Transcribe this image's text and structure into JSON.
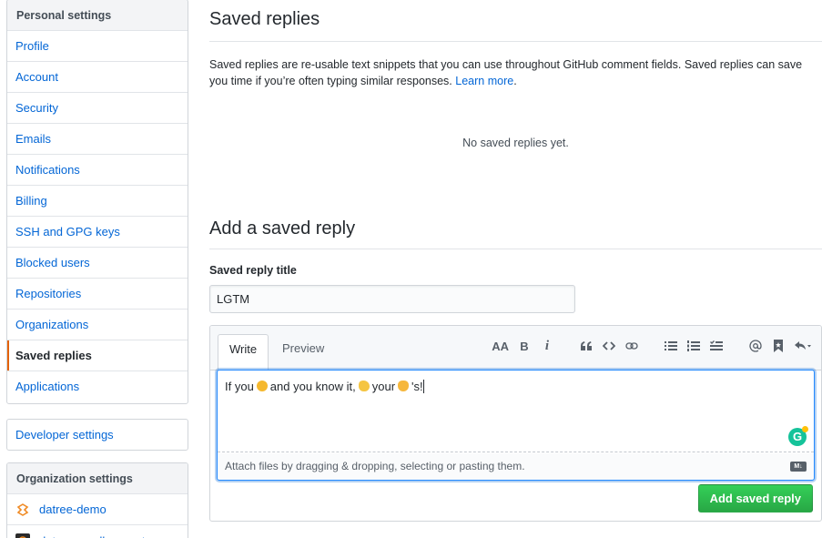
{
  "sidebar": {
    "personal_heading": "Personal settings",
    "items": [
      {
        "label": "Profile"
      },
      {
        "label": "Account"
      },
      {
        "label": "Security"
      },
      {
        "label": "Emails"
      },
      {
        "label": "Notifications"
      },
      {
        "label": "Billing"
      },
      {
        "label": "SSH and GPG keys"
      },
      {
        "label": "Blocked users"
      },
      {
        "label": "Repositories"
      },
      {
        "label": "Organizations"
      },
      {
        "label": "Saved replies",
        "selected": true
      },
      {
        "label": "Applications"
      }
    ],
    "developer_settings": "Developer settings",
    "org_heading": "Organization settings",
    "orgs": [
      {
        "label": "datree-demo"
      },
      {
        "label": "datree-sandbox-vert"
      }
    ]
  },
  "main": {
    "title": "Saved replies",
    "description": "Saved replies are re-usable text snippets that you can use throughout GitHub comment fields. Saved replies can save you time if you’re often typing similar responses.",
    "learn_more": "Learn more",
    "period": ".",
    "empty_text": "No saved replies yet.",
    "add_title": "Add a saved reply",
    "field_label": "Saved reply title",
    "title_value": "LGTM",
    "editor": {
      "tab_write": "Write",
      "tab_preview": "Preview",
      "toolbar": {
        "header": "AA",
        "bold": "B",
        "italic": "i"
      },
      "body_parts": [
        "If you",
        "and you know it,",
        "your",
        "'s!"
      ],
      "emoji_colors": [
        "#f5b82e",
        "#f5c542",
        "#f6b73c"
      ],
      "attach_text": "Attach files by dragging & dropping, selecting or pasting them.",
      "md_badge": "M↓",
      "grammarly": "G"
    },
    "submit_label": "Add saved reply"
  },
  "colors": {
    "accent": "#e36209",
    "link": "#0366d6",
    "button": "#28a745"
  }
}
